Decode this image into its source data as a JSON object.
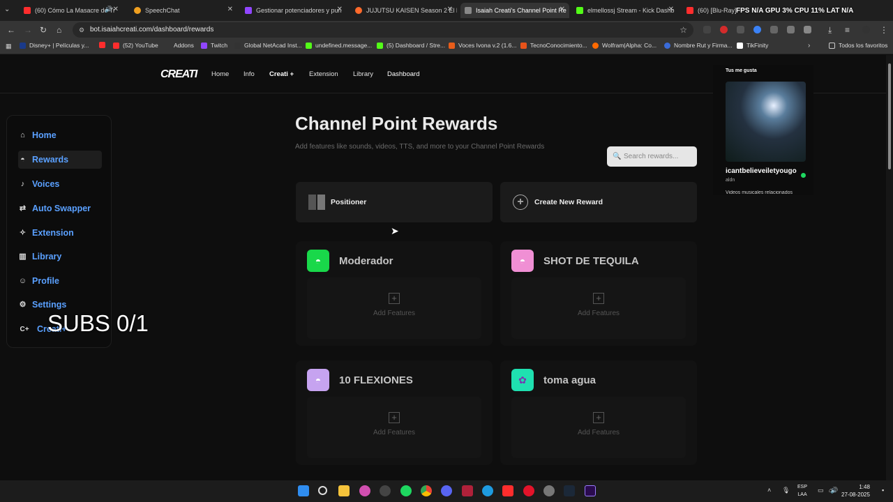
{
  "browser": {
    "tabs": [
      {
        "title": "(60) Cómo La Masacre de Tr",
        "favicon_color": "#ff2d2d",
        "active": false
      },
      {
        "title": "SpeechChat",
        "favicon_color": "#f0a020",
        "active": false
      },
      {
        "title": "Gestionar potenciadores y pun",
        "favicon_color": "#9146ff",
        "active": false
      },
      {
        "title": "JUJUTSU KAISEN Season 2 El b",
        "favicon_color": "#ff6a2b",
        "active": false
      },
      {
        "title": "Isaiah Creati's Channel Point Re",
        "favicon_color": "#888888",
        "active": true
      },
      {
        "title": "elmellossj Stream - Kick Dashb",
        "favicon_color": "#53fc18",
        "active": false
      },
      {
        "title": "(60) [Blu-Ray] Subs",
        "favicon_color": "#ff2d2d",
        "active": false
      }
    ],
    "hud_text": "FPS N/A   GPU 3%   CPU 11%   LAT N/A",
    "url": "bot.isaiahcreati.com/dashboard/rewards",
    "bookmarks": [
      {
        "label": "Disney+ | Películas y...",
        "color": "#1a3a8a"
      },
      {
        "label": "",
        "color": "#ff2d2d"
      },
      {
        "label": "(52) YouTube",
        "color": "#ff2d2d"
      },
      {
        "label": "Addons",
        "color": "#444444"
      },
      {
        "label": "Twitch",
        "color": "#9146ff"
      },
      {
        "label": "Global NetAcad Inst...",
        "color": "#333333"
      },
      {
        "label": "undefined.message...",
        "color": "#53fc18"
      },
      {
        "label": "(5) Dashboard / Stre...",
        "color": "#53fc18"
      },
      {
        "label": "Voces Ivona v.2 (1.6...",
        "color": "#e85d1a"
      },
      {
        "label": "TecnoConocimiento...",
        "color": "#e8531a"
      },
      {
        "label": "Wolfram|Alpha: Co...",
        "color": "#ff6a00"
      },
      {
        "label": "Nombre Rut y Firma...",
        "color": "#3a6bd8"
      },
      {
        "label": "TikFinity",
        "color": "#ffffff"
      }
    ],
    "all_bookmarks": "Todos los favoritos"
  },
  "site": {
    "logo": "CREATI",
    "nav": [
      "Home",
      "Info",
      "Creati +",
      "Extension",
      "Library",
      "Dashboard"
    ]
  },
  "sidebar": {
    "items": [
      {
        "label": "Home",
        "icon": "⌂"
      },
      {
        "label": "Rewards",
        "icon": "◓"
      },
      {
        "label": "Voices",
        "icon": "♪"
      },
      {
        "label": "Auto Swapper",
        "icon": "⇄"
      },
      {
        "label": "Extension",
        "icon": "✧"
      },
      {
        "label": "Library",
        "icon": "▥"
      },
      {
        "label": "Profile",
        "icon": "☺"
      },
      {
        "label": "Settings",
        "icon": "⚙"
      },
      {
        "label": "Creati+",
        "icon": "C+"
      }
    ],
    "overlay_text": "SUBS 0/1"
  },
  "main": {
    "title": "Channel Point Rewards",
    "description": "Add features like sounds, videos, TTS, and more to your Channel Point Rewards",
    "search_placeholder": "Search rewards...",
    "positioner_label": "Positioner",
    "create_label": "Create New Reward",
    "add_features_label": "Add Features",
    "rewards": [
      {
        "name": "Moderador",
        "icon_color": "#19d84a"
      },
      {
        "name": "SHOT DE TEQUILA",
        "icon_color": "#f08fd4"
      },
      {
        "name": "10 FLEXIONES",
        "icon_color": "#c6a3f0"
      },
      {
        "name": "toma agua",
        "icon_color": "#1fe0b0"
      }
    ]
  },
  "media_popup": {
    "label": "Tus me gusta",
    "title": "icantbelieveiletyougo",
    "artist": "aldn",
    "more": "Videos musicales relacionados"
  },
  "taskbar": {
    "lang_top": "ESP",
    "lang_bottom": "LAA",
    "time": "1:48",
    "date": "27-08-2025"
  }
}
